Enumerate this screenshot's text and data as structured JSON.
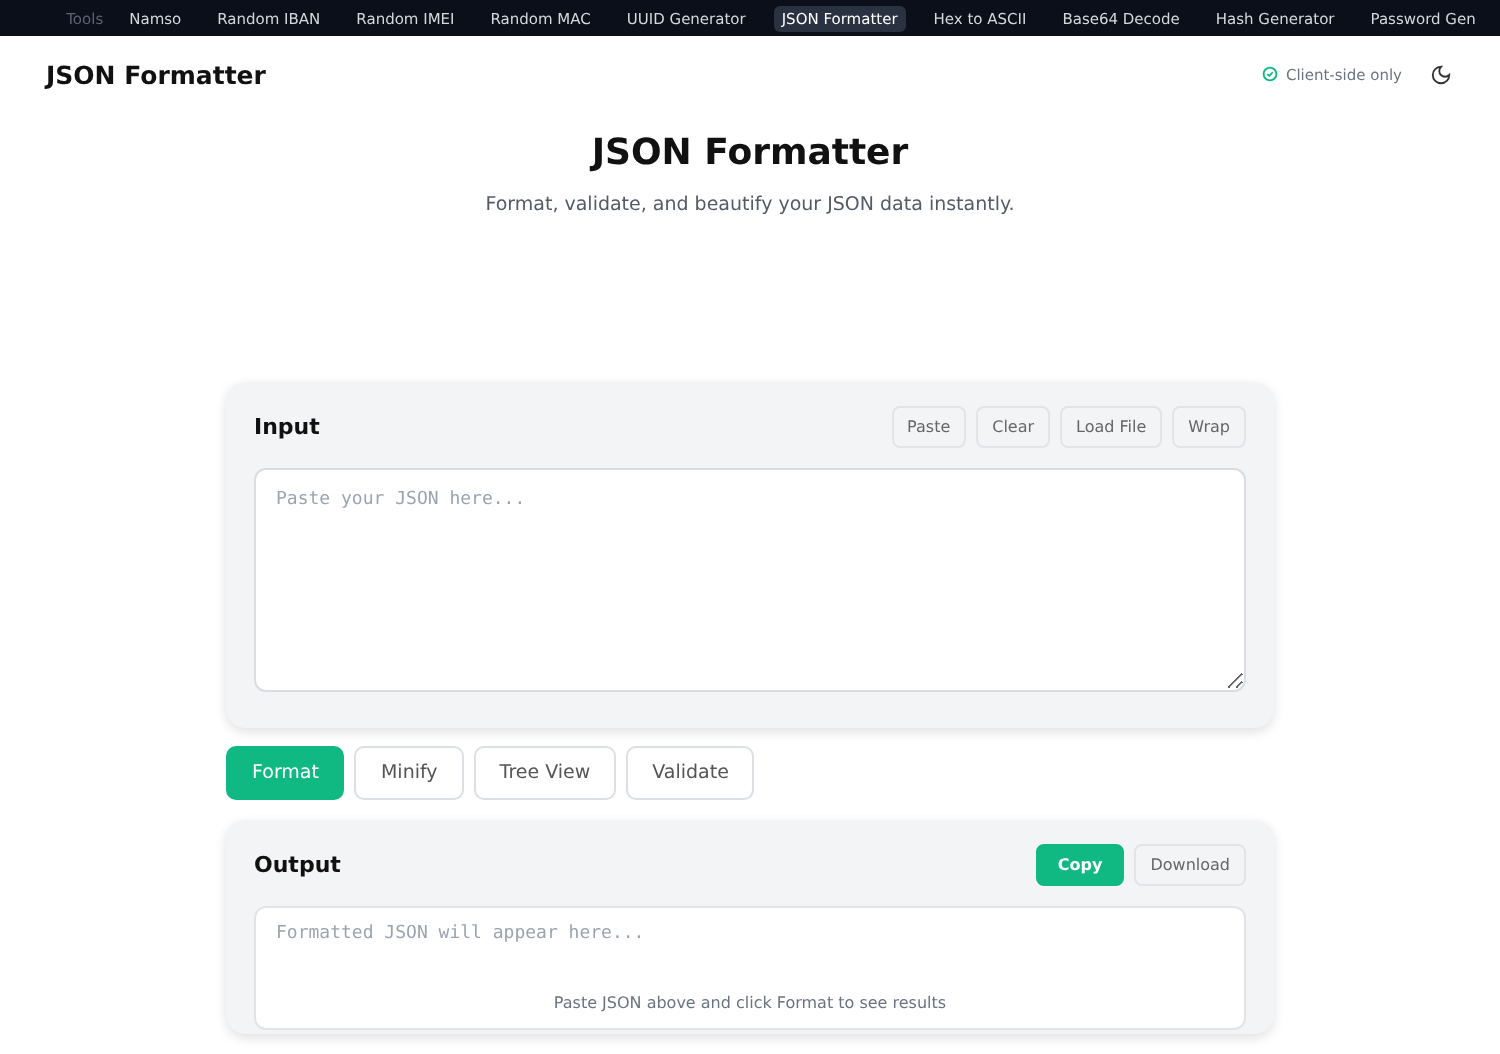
{
  "top_nav": {
    "label": "Tools",
    "items": [
      {
        "label": "Namso",
        "selected": false
      },
      {
        "label": "Random IBAN",
        "selected": false
      },
      {
        "label": "Random IMEI",
        "selected": false
      },
      {
        "label": "Random MAC",
        "selected": false
      },
      {
        "label": "UUID Generator",
        "selected": false
      },
      {
        "label": "JSON Formatter",
        "selected": true
      },
      {
        "label": "Hex to ASCII",
        "selected": false
      },
      {
        "label": "Base64 Decode",
        "selected": false
      },
      {
        "label": "Hash Generator",
        "selected": false
      },
      {
        "label": "Password Gen",
        "selected": false
      }
    ]
  },
  "header": {
    "title": "JSON Formatter",
    "badge": "Client-side only"
  },
  "hero": {
    "title": "JSON Formatter",
    "subtitle": "Format, validate, and beautify your JSON data instantly."
  },
  "input": {
    "title": "Input",
    "actions": [
      {
        "label": "Paste",
        "kind": "secondary"
      },
      {
        "label": "Clear",
        "kind": "secondary"
      },
      {
        "label": "Load File",
        "kind": "secondary"
      },
      {
        "label": "Wrap",
        "kind": "secondary"
      }
    ],
    "placeholder": "Paste your JSON here..."
  },
  "modes": [
    {
      "label": "Format",
      "selected": true
    },
    {
      "label": "Minify",
      "selected": false
    },
    {
      "label": "Tree View",
      "selected": false
    },
    {
      "label": "Validate",
      "selected": false
    }
  ],
  "output": {
    "title": "Output",
    "actions": [
      {
        "label": "Copy",
        "kind": "primary"
      },
      {
        "label": "Download",
        "kind": "secondary"
      }
    ],
    "placeholder": "Formatted JSON will appear here...",
    "hint": "Paste JSON above and click Format to see results"
  }
}
